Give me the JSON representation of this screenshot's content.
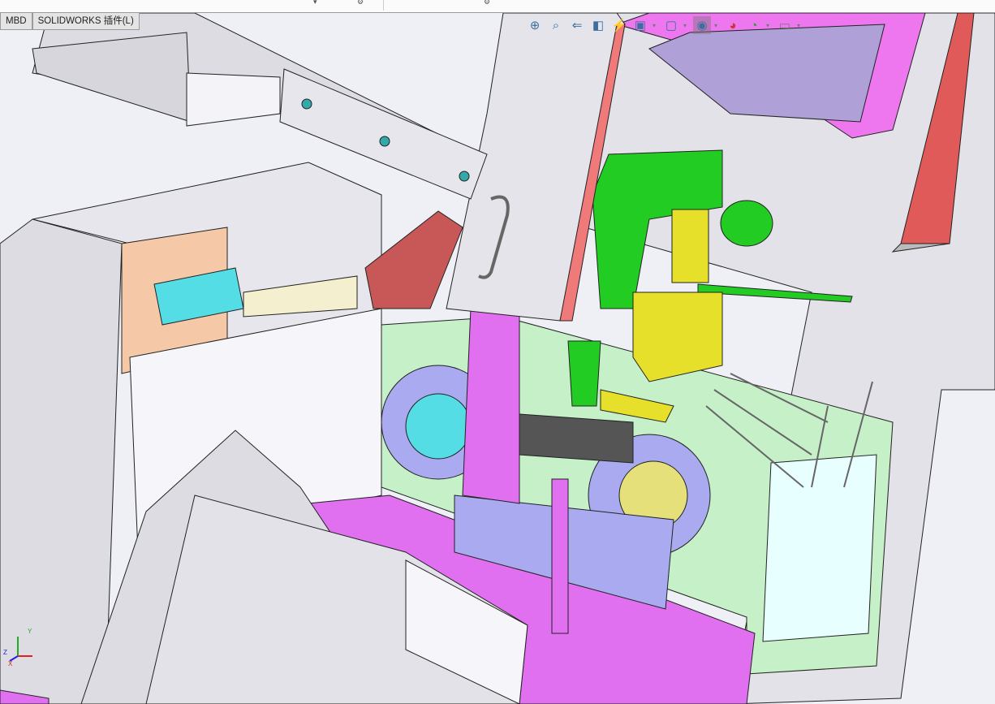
{
  "app": "SOLIDWORKS",
  "command_tabs": [
    {
      "label": "MBD"
    },
    {
      "label": "SOLIDWORKS 插件(L)"
    }
  ],
  "heads_up_toolbar": [
    {
      "icon": "zoom-to-fit-icon",
      "glyph": "⊕"
    },
    {
      "icon": "zoom-to-area-icon",
      "glyph": "⌕"
    },
    {
      "icon": "previous-view-icon",
      "glyph": "⇐"
    },
    {
      "icon": "section-view-icon",
      "glyph": "◧"
    },
    {
      "icon": "dynamic-annotation-icon",
      "glyph": "⚡"
    },
    {
      "icon": "view-orientation-icon",
      "glyph": "▣"
    },
    {
      "icon": "display-style-icon",
      "glyph": "▢"
    },
    {
      "icon": "hide-show-items-icon",
      "glyph": "◉"
    },
    {
      "icon": "edit-appearance-icon",
      "glyph": "◕"
    },
    {
      "icon": "apply-scene-icon",
      "glyph": "◔"
    },
    {
      "icon": "view-settings-icon",
      "glyph": "▭"
    }
  ],
  "triad": {
    "x": "X",
    "y": "Y",
    "z": "Z"
  },
  "colors": {
    "pink": "#e070f0",
    "green": "#22cc22",
    "yellow": "#e6e02a",
    "lavender": "#a9aaf0",
    "cyan": "#55dde6",
    "mint": "#c6f0c8",
    "gray": "#dcdce2",
    "red": "#c85858"
  }
}
